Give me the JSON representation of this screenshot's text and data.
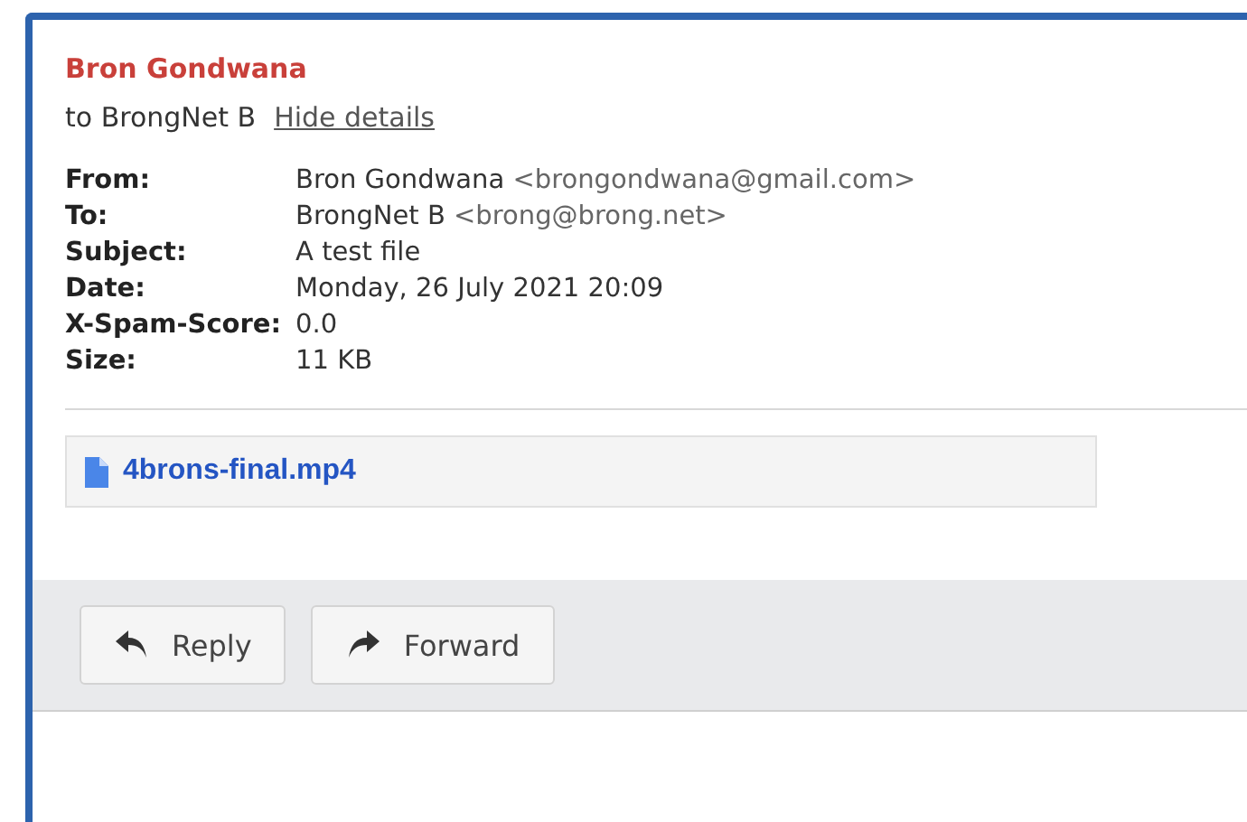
{
  "sender": {
    "name": "Bron Gondwana"
  },
  "recipient_line": {
    "text": "to BrongNet B",
    "link": "Hide details"
  },
  "headers": [
    {
      "label": "From:",
      "name": "Bron Gondwana",
      "address": "<brongondwana@gmail.com>"
    },
    {
      "label": "To:",
      "name": "BrongNet B",
      "address": "<brong@brong.net>"
    },
    {
      "label": "Subject:",
      "name": "A test file"
    },
    {
      "label": "Date:",
      "name": "Monday, 26 July 2021 20:09"
    },
    {
      "label": "X-Spam-Score:",
      "name": "0.0"
    },
    {
      "label": "Size:",
      "name": "11 KB"
    }
  ],
  "attachments": [
    {
      "name": "4brons-final.mp4"
    }
  ],
  "actions": [
    {
      "kind": "reply",
      "label": "Reply"
    },
    {
      "kind": "forward",
      "label": "Forward"
    }
  ]
}
